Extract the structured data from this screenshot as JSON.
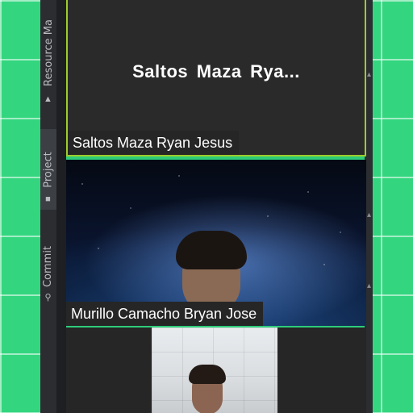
{
  "side_tabs": [
    {
      "label": "Resource Ma",
      "icon": "resource-manager-icon"
    },
    {
      "label": "Project",
      "icon": "folder-icon"
    },
    {
      "label": "Commit",
      "icon": "commit-icon"
    }
  ],
  "participants": [
    {
      "name": "Saltos Maza Ryan Jesus",
      "display_short": "Saltos Maza Rya...",
      "camera": "off",
      "active_speaker": true
    },
    {
      "name": "Murillo Camacho Bryan Jose",
      "camera": "on"
    },
    {
      "name": "",
      "camera": "on"
    }
  ],
  "colors": {
    "active_speaker_border": "#9ccc2c",
    "green_background": "#33d67f"
  }
}
